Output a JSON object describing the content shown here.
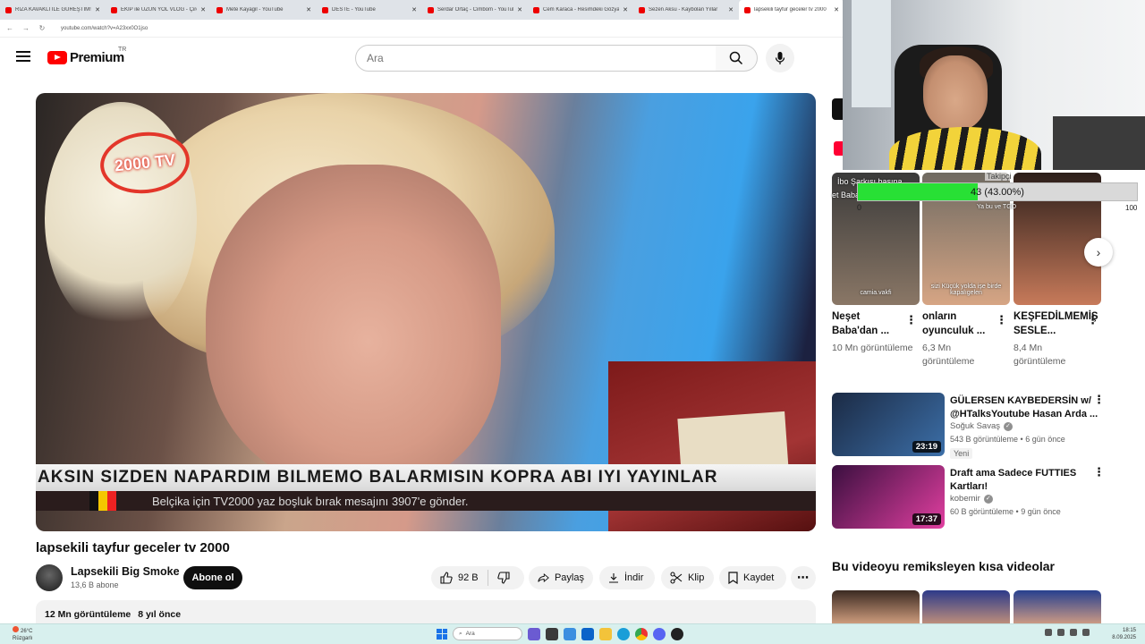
{
  "browser": {
    "tabs": [
      {
        "title": "RIZA KAVAKLI İLE GÜREŞTİM!",
        "active": false
      },
      {
        "title": "EKİP ile UZUN YOL VLOG - Çiro",
        "active": false
      },
      {
        "title": "Mete Kayagil - YouTube",
        "active": false
      },
      {
        "title": "DESTE - YouTube",
        "active": false
      },
      {
        "title": "Serdar Ortaç - Cimbom - YouTube",
        "active": false
      },
      {
        "title": "Cem Karaca - Resimdeki Gözyaşları",
        "active": false
      },
      {
        "title": "Sezen Aksu - Kaybolan Yıllar",
        "active": false
      },
      {
        "title": "lapsekili tayfur geceler tv 2000",
        "active": true
      }
    ],
    "url": "youtube.com/watch?v=A23xx0O1jso"
  },
  "header": {
    "logo_text": "Premium",
    "country_code": "TR",
    "search_placeholder": "Ara"
  },
  "player": {
    "channel_logo": "2000 TV",
    "ticker_text": "AKSIN SIZDEN NAPARDIM BILMEMO BALARMISIN KOPRA ABI IYI YAYINLAR",
    "sub_ticker_text": "Belçika için TV2000 yaz boşluk bırak mesajını 3907'e gönder."
  },
  "video": {
    "title": "lapsekili tayfur geceler tv 2000",
    "channel_name": "Lapsekili Big Smoke",
    "subscribers": "13,6 B abone",
    "subscribe_label": "Abone ol",
    "like_count": "92 B",
    "share_label": "Paylaş",
    "download_label": "İndir",
    "clip_label": "Klip",
    "save_label": "Kaydet",
    "views": "12 Mn görüntüleme",
    "age": "8 yıl önce"
  },
  "overlay": {
    "goal_label": "Takipçi",
    "goal_text": "43 (43.00%)",
    "goal_fraction": 0.43,
    "goal_min": "0",
    "goal_max": "100",
    "thumb_text_1": "İbo Şarkısı başına",
    "thumb_text_2": "et Baba",
    "thumb_text_3": "Ya bu ve TGO"
  },
  "shorts": [
    {
      "title": "Neşet Baba'dan ...",
      "views": "10 Mn görüntüleme",
      "caption": "camia.vakfi",
      "color_a": "#3a3a3a",
      "color_b": "#8a7766"
    },
    {
      "title": "onların oyunculuk ...",
      "views": "6,3 Mn görüntüleme",
      "caption": "sizi Küçük yolda işe birde kapalıgelen",
      "color_a": "#6f6a62",
      "color_b": "#d6a584"
    },
    {
      "title": "KEŞFEDİLMEMİŞ SESLE...",
      "views": "8,4 Mn görüntüleme",
      "caption": "",
      "color_a": "#2b1e1a",
      "color_b": "#c77a5a"
    }
  ],
  "recommended": [
    {
      "title": "GÜLERSEN KAYBEDERSİN w/ @HTalksYoutube Hasan Arda ...",
      "channel": "Soğuk Savaş",
      "meta": "543 B görüntüleme • 6 gün önce",
      "duration": "23:19",
      "badge": "Yeni",
      "color_a": "#1b2a44",
      "color_b": "#3c6fa8"
    },
    {
      "title": "Draft ama Sadece FUTTIES Kartları!",
      "channel": "kobemir",
      "meta": "60 B görüntüleme • 9 gün önce",
      "duration": "17:37",
      "badge": "",
      "color_a": "#3a0f3f",
      "color_b": "#e13fa0"
    }
  ],
  "remix_heading": "Bu videoyu remiksleyen kısa videolar",
  "taskbar": {
    "temperature": "26°C",
    "weather_text": "Rüzgarlı",
    "search_text": "Ara",
    "time": "18:15",
    "date": "8.09.2025"
  }
}
